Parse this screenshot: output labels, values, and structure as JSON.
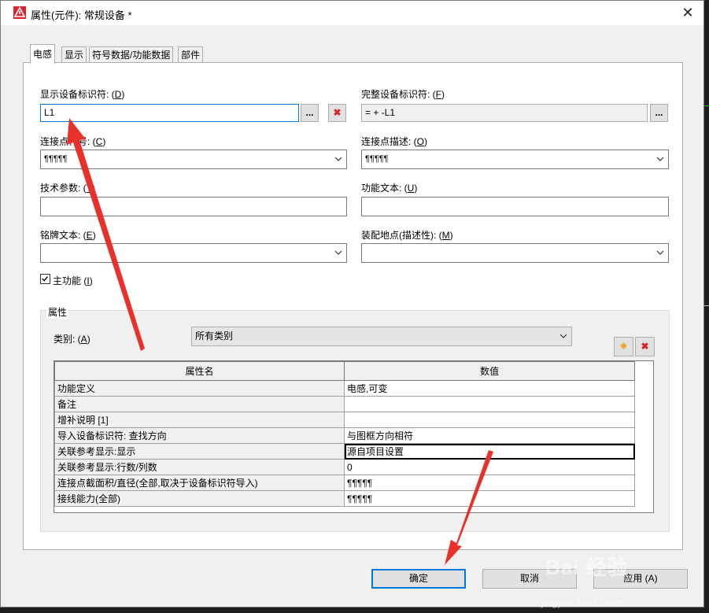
{
  "window": {
    "title": "属性(元件): 常规设备 *",
    "close_glyph": "✕"
  },
  "tabs": [
    "电感",
    "显示",
    "符号数据/功能数据",
    "部件"
  ],
  "fields": {
    "display_dt": {
      "label": "显示设备标识符: (",
      "key": "D",
      "label_end": ")",
      "value": "L1",
      "browse": "...",
      "delete": "✖"
    },
    "full_dt": {
      "label": "完整设备标识符: (",
      "key": "F",
      "label_end": ")",
      "value": "= + -L1",
      "browse": "..."
    },
    "conn_designation": {
      "label": "连接点代号: (",
      "key": "C",
      "label_end": ")",
      "value": "¶¶¶¶¶"
    },
    "conn_description": {
      "label": "连接点描述: (",
      "key": "O",
      "label_end": ")",
      "value": "¶¶¶¶¶"
    },
    "tech_params": {
      "label": "技术参数: (",
      "key": "T",
      "label_end": ")",
      "value": ""
    },
    "function_text": {
      "label": "功能文本: (",
      "key": "U",
      "label_end": ")",
      "value": ""
    },
    "nameplate_text": {
      "label": "铭牌文本: (",
      "key": "E",
      "label_end": ")",
      "value": ""
    },
    "mounting_site": {
      "label": "装配地点(描述性): (",
      "key": "M",
      "label_end": ")",
      "value": ""
    }
  },
  "main_function": {
    "label": "主功能 (",
    "key": "I",
    "label_end": ")",
    "checked": true
  },
  "properties": {
    "group_label": "属性",
    "category_label": "类别: (",
    "category_key": "A",
    "category_label_end": ")",
    "category_value": "所有类别",
    "add_glyph": "✷",
    "delete_glyph": "✖",
    "columns": [
      "属性名",
      "数值"
    ],
    "rows": [
      [
        "功能定义",
        "电感,可变"
      ],
      [
        "备注",
        ""
      ],
      [
        "增补说明 [1]",
        ""
      ],
      [
        "导入设备标识符: 查找方向",
        "与图框方向相符"
      ],
      [
        "关联参考显示:显示",
        "源自项目设置"
      ],
      [
        "关联参考显示:行数/列数",
        "0"
      ],
      [
        "连接点截面积/直径(全部,取决于设备标识符导入)",
        "¶¶¶¶¶"
      ],
      [
        "接线能力(全部)",
        "¶¶¶¶¶"
      ]
    ]
  },
  "buttons": {
    "ok": "确定",
    "cancel": "取消",
    "apply": "应用 (A)"
  },
  "colors": {
    "focus": "#0078d7",
    "cad_green": "#00c000",
    "annotation_arrow": "#e8312b"
  },
  "watermark": {
    "brand": "Bai 经验",
    "url": "jingyan.baidu.com"
  }
}
